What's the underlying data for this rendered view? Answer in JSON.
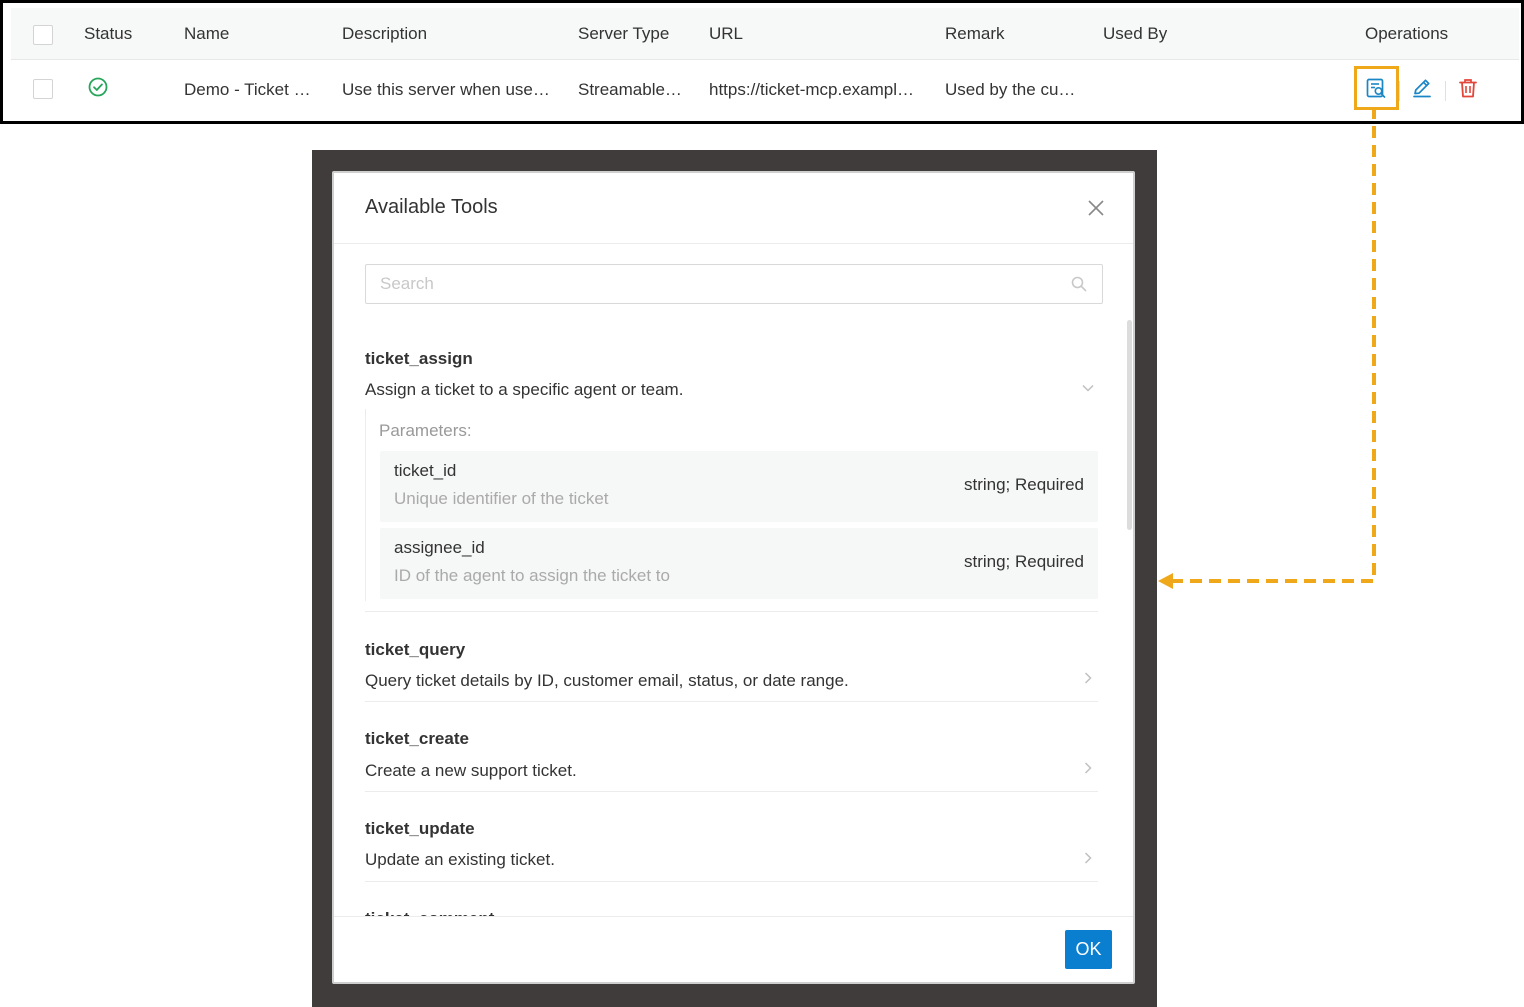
{
  "table": {
    "headers": {
      "status": "Status",
      "name": "Name",
      "description": "Description",
      "server_type": "Server Type",
      "url": "URL",
      "remark": "Remark",
      "used_by": "Used By",
      "operations": "Operations"
    },
    "row": {
      "status_icon": "check-circle-icon",
      "name": "Demo - Ticket …",
      "description": "Use this server when use…",
      "server_type": "Streamable…",
      "url": "https://ticket-mcp.exampl…",
      "remark": "Used by the cu…",
      "used_by": ""
    },
    "colors": {
      "status_ok": "#26a55b",
      "view": "#1a86c6",
      "edit": "#1a86c6",
      "delete": "#e2463a",
      "highlight": "#f0a81b"
    }
  },
  "modal": {
    "title": "Available Tools",
    "search_placeholder": "Search",
    "parameters_label": "Parameters:",
    "ok_label": "OK",
    "tools": [
      {
        "name": "ticket_assign",
        "description": "Assign a ticket to a specific agent or team.",
        "expanded": true,
        "params": [
          {
            "name": "ticket_id",
            "description": "Unique identifier of the ticket",
            "type": "string; Required"
          },
          {
            "name": "assignee_id",
            "description": "ID of the agent to assign the ticket to",
            "type": "string; Required"
          }
        ]
      },
      {
        "name": "ticket_query",
        "description": "Query ticket details by ID, customer email, status, or date range.",
        "expanded": false
      },
      {
        "name": "ticket_create",
        "description": "Create a new support ticket.",
        "expanded": false
      },
      {
        "name": "ticket_update",
        "description": "Update an existing ticket.",
        "expanded": false
      },
      {
        "name": "ticket_comment",
        "description": "",
        "expanded": false
      }
    ]
  }
}
